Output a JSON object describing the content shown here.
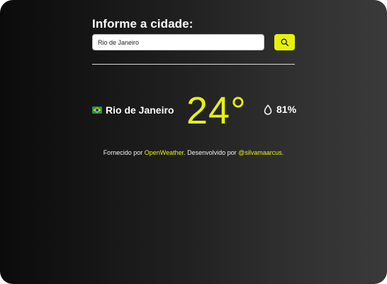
{
  "search": {
    "title": "Informe a cidade:",
    "value": "Rio de Janeiro",
    "button_icon": "search-icon"
  },
  "weather": {
    "flag_icon": "brazil-flag-icon",
    "city": "Rio de Janeiro",
    "temperature": "24°",
    "humidity_icon": "water-drop-icon",
    "humidity": "81%"
  },
  "footer": {
    "prefix": "Fornecido por ",
    "provider_link": "OpenWeather",
    "middle": ". Desenvolvido por ",
    "author_link": "@silvamaarcus",
    "suffix": "."
  },
  "colors": {
    "accent": "#e6f20c",
    "background_dark": "#0b0b0b",
    "background_light": "#3a3a3a",
    "text": "#ffffff"
  }
}
